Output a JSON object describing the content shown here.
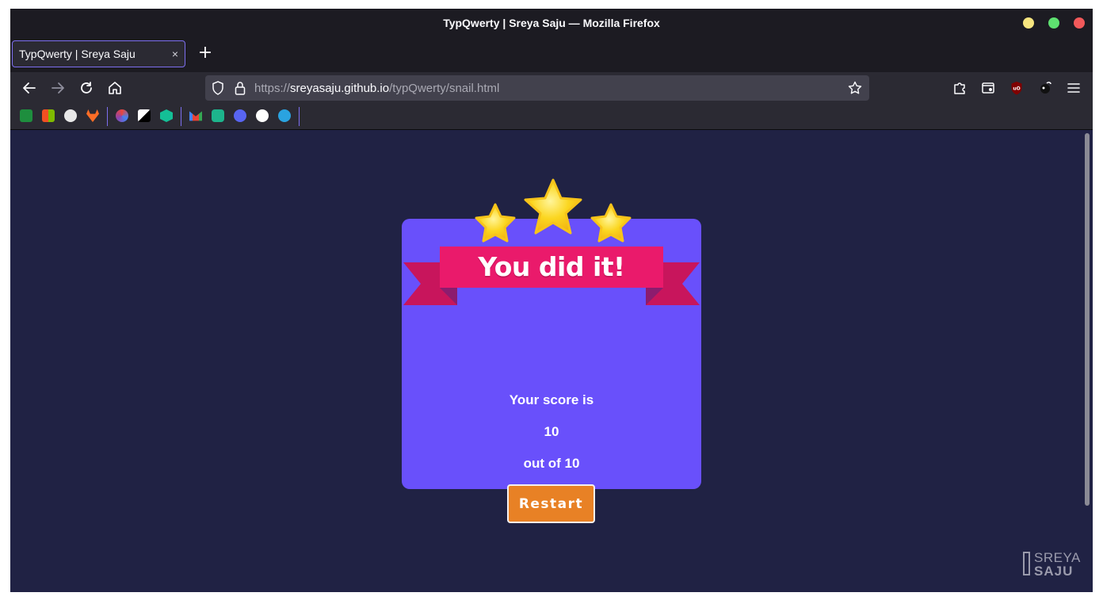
{
  "window": {
    "title": "TypQwerty | Sreya Saju — Mozilla Firefox"
  },
  "tab": {
    "title": "TypQwerty | Sreya Saju",
    "close_glyph": "×",
    "new_tab_glyph": "+"
  },
  "urlbar": {
    "scheme": "https://",
    "host": "sreyasaju.github.io",
    "path": "/typQwerty/snail.html"
  },
  "bookmarks": {
    "icons": [
      "classroom-icon",
      "microsoft-icon",
      "github-icon",
      "gitlab-icon",
      "edge-icon",
      "notion-icon",
      "khan-academy-icon",
      "gmail-icon",
      "sync-icon",
      "discord-icon",
      "whatsapp-icon",
      "telegram-icon"
    ]
  },
  "game": {
    "banner_title": "You did it!",
    "score_label": "Your score is",
    "score_value": "10",
    "score_total": "out of 10",
    "restart_label": "Restart"
  },
  "watermark": {
    "line1": "SREYA",
    "line2": "SAJU"
  },
  "colors": {
    "page_bg": "#202244",
    "card_bg": "#6950fb",
    "ribbon": "#ea1a6b",
    "ribbon_dark": "#c8155c",
    "star": "#fbd620",
    "restart_bg": "#e88125"
  }
}
